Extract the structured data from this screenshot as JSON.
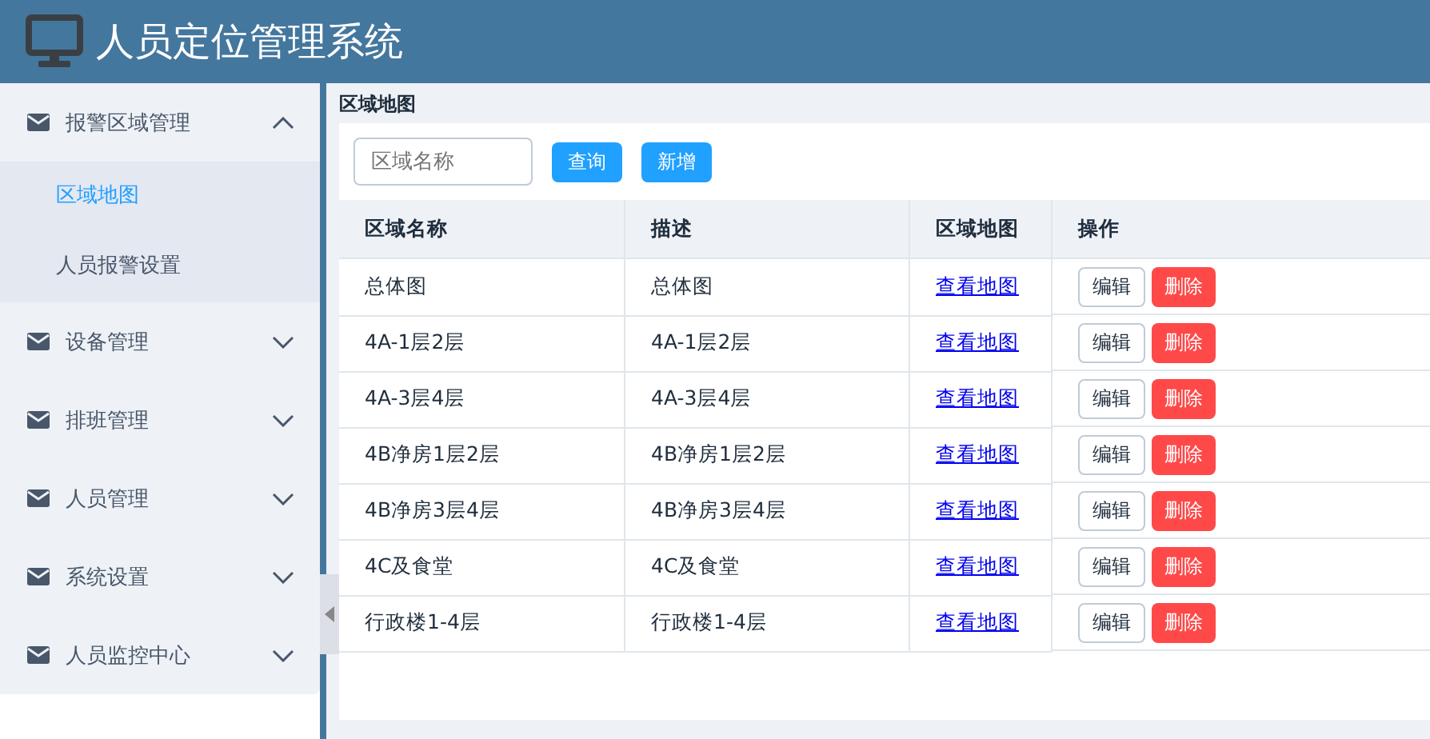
{
  "header": {
    "title": "人员定位管理系统"
  },
  "sidebar": {
    "groups": [
      {
        "label": "报警区域管理",
        "expanded": true,
        "children": [
          {
            "label": "区域地图",
            "selected": true
          },
          {
            "label": "人员报警设置",
            "selected": false
          }
        ]
      },
      {
        "label": "设备管理",
        "expanded": false
      },
      {
        "label": "排班管理",
        "expanded": false
      },
      {
        "label": "人员管理",
        "expanded": false
      },
      {
        "label": "系统设置",
        "expanded": false
      },
      {
        "label": "人员监控中心",
        "expanded": false
      }
    ]
  },
  "page_title": "区域地图",
  "search": {
    "placeholder": "区域名称"
  },
  "buttons": [
    "查询",
    "新增"
  ],
  "table": {
    "columns": [
      "区域名称",
      "描述",
      "区域地图",
      "操作"
    ],
    "rows": [
      {
        "name": "总体图",
        "description": "总体图",
        "link": "查看地图",
        "actions": [
          "编辑",
          "删除"
        ]
      },
      {
        "name": "4A-1层2层",
        "description": "4A-1层2层",
        "link": "查看地图",
        "actions": [
          "编辑",
          "删除"
        ]
      },
      {
        "name": "4A-3层4层",
        "description": "4A-3层4层",
        "link": "查看地图",
        "actions": [
          "编辑",
          "删除"
        ]
      },
      {
        "name": "4B净房1层2层",
        "description": "4B净房1层2层",
        "link": "查看地图",
        "actions": [
          "编辑",
          "删除"
        ]
      },
      {
        "name": "4B净房3层4层",
        "description": "4B净房3层4层",
        "link": "查看地图",
        "actions": [
          "编辑",
          "删除"
        ]
      },
      {
        "name": "4C及食堂",
        "description": "4C及食堂",
        "link": "查看地图",
        "actions": [
          "编辑",
          "删除"
        ]
      },
      {
        "name": "行政楼1-4层",
        "description": "行政楼1-4层",
        "link": "查看地图",
        "actions": [
          "编辑",
          "删除"
        ]
      }
    ]
  }
}
